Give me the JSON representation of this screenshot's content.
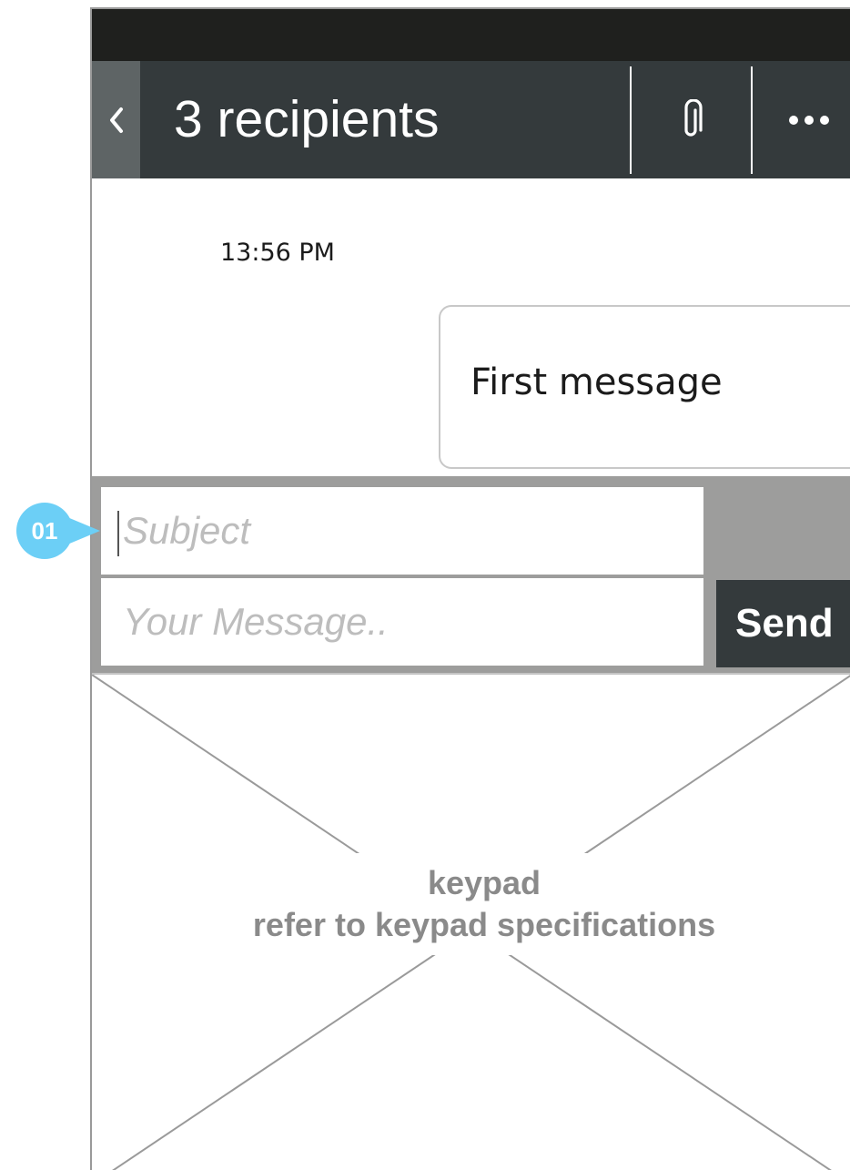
{
  "header": {
    "back_icon": "chevron-left-icon",
    "title": "3 recipients",
    "attach_icon": "paperclip-icon",
    "more_icon": "more-horizontal-icon"
  },
  "conversation": {
    "timestamp": "13:56 PM",
    "messages": [
      {
        "text": "First message"
      }
    ]
  },
  "compose": {
    "subject_placeholder": "Subject",
    "message_placeholder": "Your Message..",
    "send_label": "Send"
  },
  "keypad": {
    "line1": "keypad",
    "line2": "refer to keypad specifications"
  },
  "annotation": {
    "label": "01",
    "color": "#6ccff6"
  },
  "colors": {
    "status_bar": "#1f201e",
    "header": "#343a3c",
    "back_button": "#5e6465",
    "compose_bg": "#9d9d9c",
    "send_button": "#343a3c"
  }
}
